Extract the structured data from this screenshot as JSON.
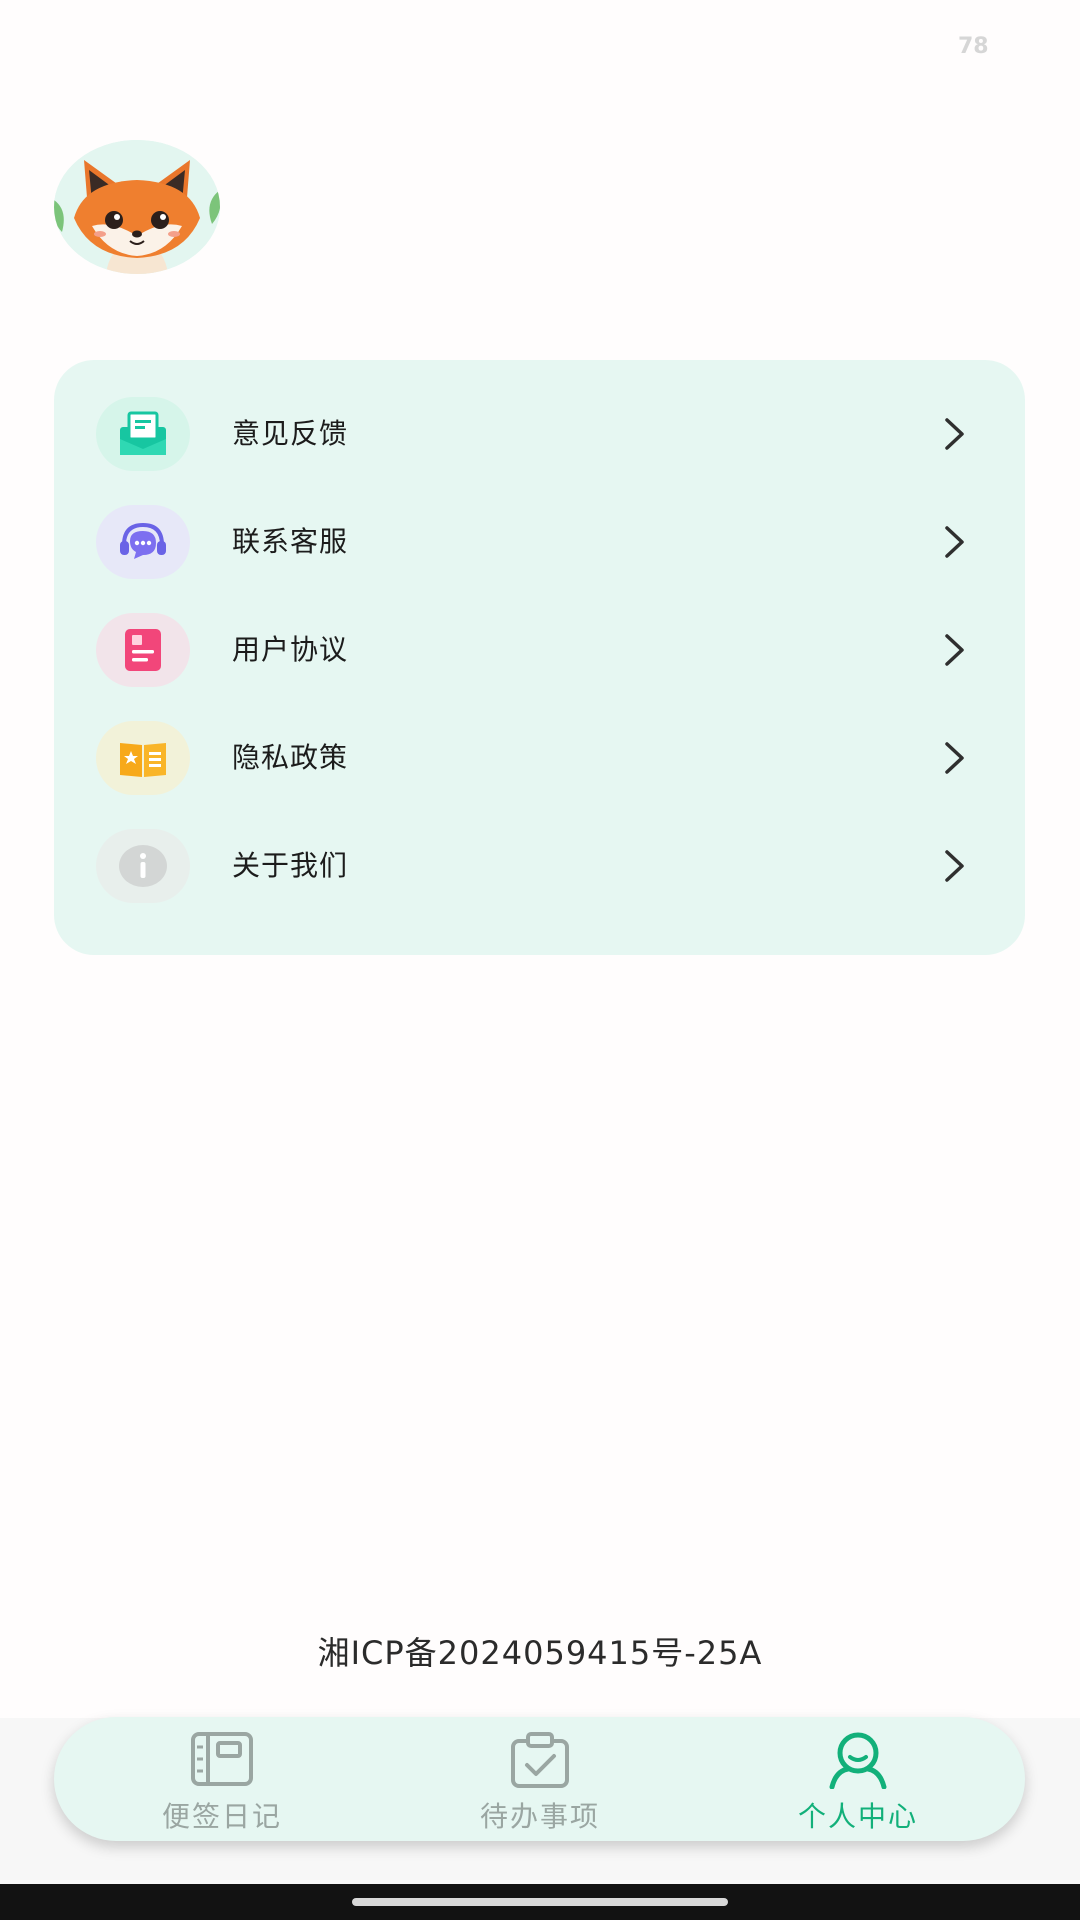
{
  "status": {
    "number": "78"
  },
  "profile": {
    "avatar_icon": "fox-avatar-icon"
  },
  "menu": {
    "items": [
      {
        "label": "意见反馈",
        "icon": "feedback-mail-icon",
        "icon_bg": "#d6f5ea"
      },
      {
        "label": "联系客服",
        "icon": "customer-service-headset-icon",
        "icon_bg": "#e7e8f8"
      },
      {
        "label": "用户协议",
        "icon": "agreement-document-icon",
        "icon_bg": "#f2e4ea"
      },
      {
        "label": "隐私政策",
        "icon": "privacy-book-icon",
        "icon_bg": "#f2f2d9"
      },
      {
        "label": "关于我们",
        "icon": "info-icon",
        "icon_bg": "#e8efec"
      }
    ]
  },
  "footer": {
    "icp": "湘ICP备2024059415号-25A"
  },
  "tabs": [
    {
      "label": "便签日记",
      "icon": "notebook-icon",
      "active": false
    },
    {
      "label": "待办事项",
      "icon": "clipboard-check-icon",
      "active": false
    },
    {
      "label": "个人中心",
      "icon": "user-profile-icon",
      "active": true
    }
  ],
  "colors": {
    "accent": "#12b07a",
    "card_bg": "#e6f7f2",
    "inactive_tab": "#9aa6a2"
  }
}
